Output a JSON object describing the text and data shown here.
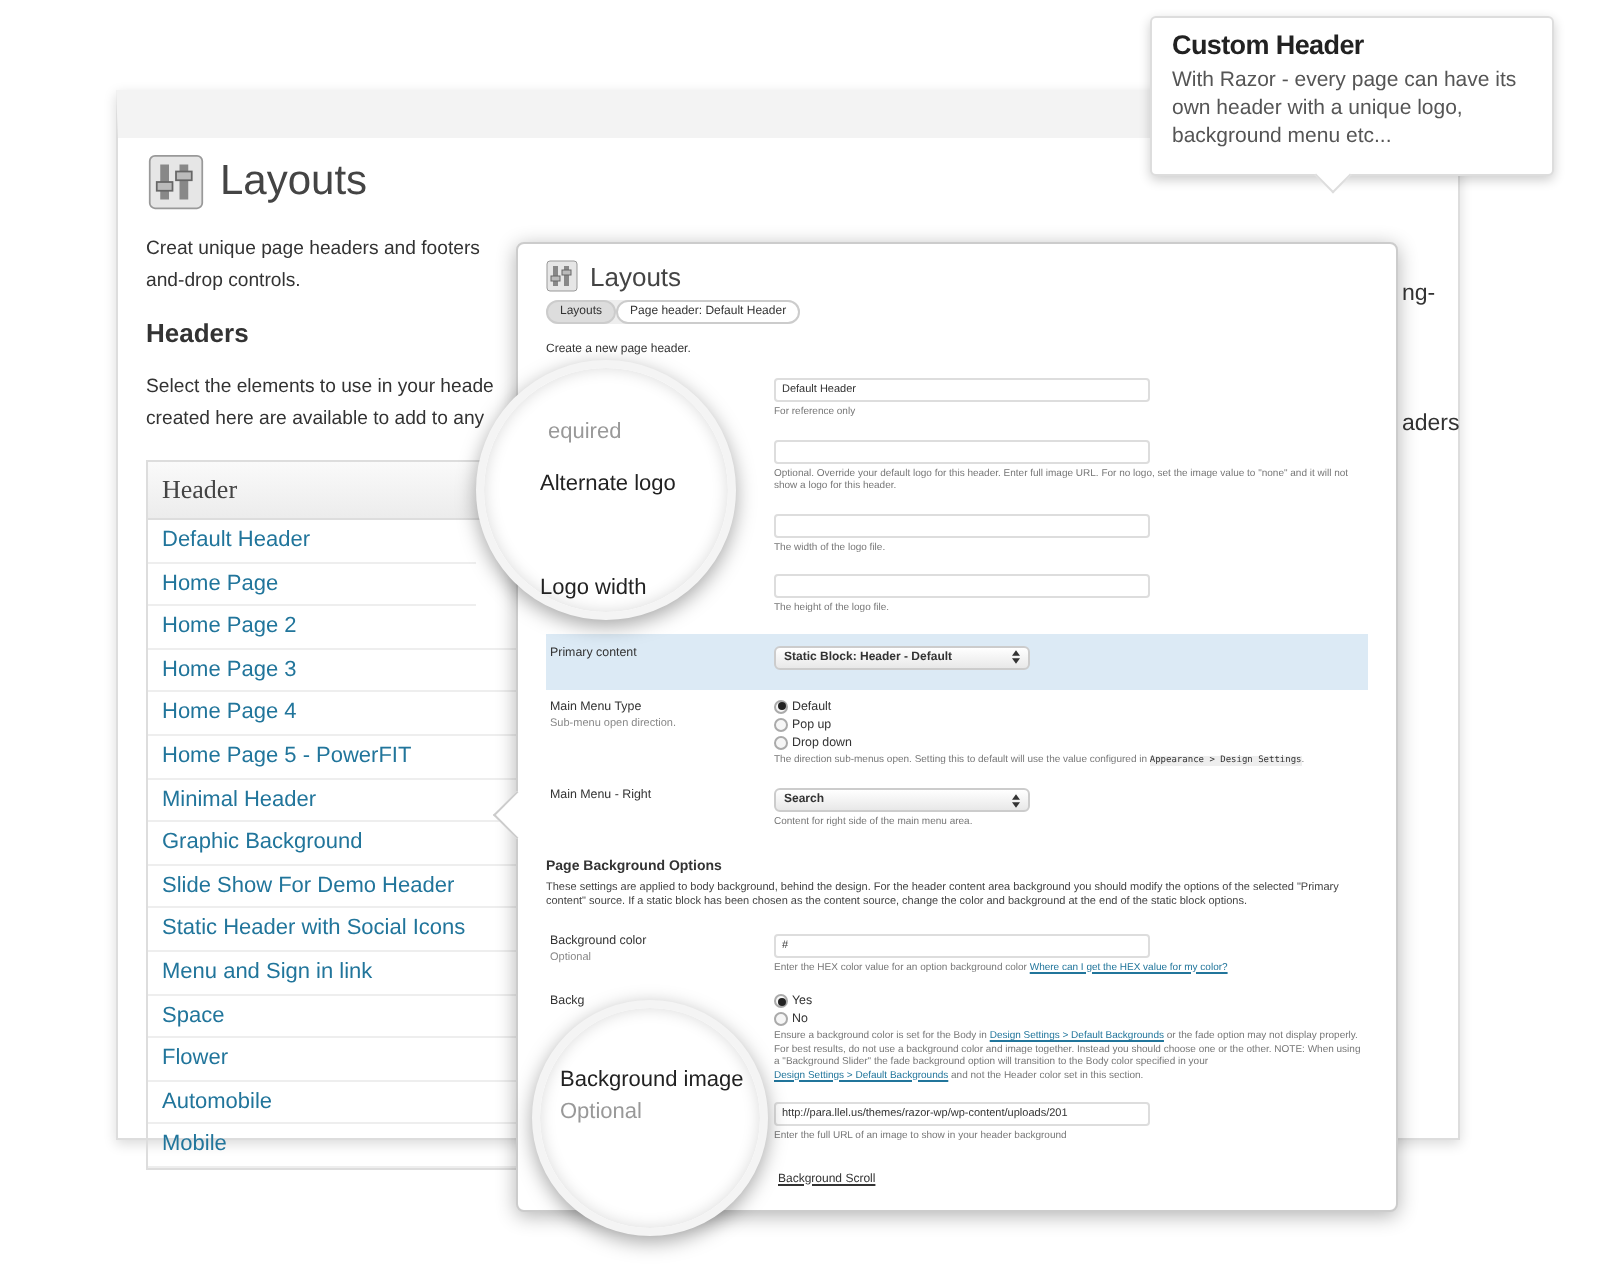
{
  "back_page": {
    "title": "Layouts",
    "intro": "Creat unique page headers and footers",
    "intro_cont": "and-drop controls.",
    "intro_edge": "ng-",
    "section_title": "Headers",
    "section_text": "Select the elements to use in your heade",
    "section_text_2": "created here are available to add to any",
    "section_edge": "aders",
    "table": {
      "columns": [
        "Header"
      ],
      "rows": [
        "Default Header",
        "Home Page",
        "Home Page 2",
        "Home Page 3",
        "Home Page 4",
        "Home Page 5 - PowerFIT",
        "Minimal Header",
        "Graphic Background",
        "Slide Show For Demo Header",
        "Static Header with Social Icons",
        "Menu and Sign in link",
        "Space",
        "Flower",
        "Automobile",
        "Mobile"
      ]
    }
  },
  "popup": {
    "title": "Layouts",
    "tabs": [
      {
        "label": "Layouts",
        "selected": true
      },
      {
        "label": "Page header: Default Header",
        "selected": false
      }
    ],
    "intro": "Create a new page header.",
    "rows": [
      {
        "kind": "text",
        "value": "Default Header",
        "help": [
          {
            "kind": "text",
            "text": "For reference only"
          }
        ]
      },
      {
        "kind": "text",
        "help": [
          {
            "kind": "text",
            "text": "Optional. Override your default logo for this header. Enter full image URL. For no logo, set the image value to \"none\" and it will not show a logo for this header."
          }
        ]
      },
      {
        "kind": "text",
        "help": [
          {
            "kind": "text",
            "text": "The width of the logo file."
          }
        ]
      },
      {
        "kind": "text",
        "help": [
          {
            "kind": "text",
            "text": "The height of the logo file."
          }
        ]
      },
      {
        "kind": "select",
        "label": "Primary content",
        "highlighted": true,
        "value": "Static Block: Header - Default"
      },
      {
        "kind": "radio",
        "label": "Main Menu Type",
        "sublabel": "Sub-menu open direction.",
        "options": [
          {
            "label": "Default",
            "selected": true
          },
          {
            "label": "Pop up",
            "selected": false
          },
          {
            "label": "Drop down",
            "selected": false
          }
        ],
        "help": [
          {
            "kind": "text",
            "text": "The direction sub-menus open. Setting this to default will use the value configured in "
          },
          {
            "kind": "code",
            "text": "Appearance > Design Settings"
          },
          {
            "kind": "text",
            "text": "."
          }
        ]
      },
      {
        "kind": "select",
        "label": "Main Menu - Right",
        "highlighted": false,
        "value": "Search",
        "help": [
          {
            "kind": "text",
            "text": "Content for right side of the main menu area."
          }
        ]
      },
      {
        "kind": "heading",
        "text": "Page Background Options"
      },
      {
        "kind": "paragraph",
        "text": "These settings are applied to body background, behind the design. For the header content area background you should modify the options of the selected \"Primary content\" source. If a static block has been chosen as the content source, change the color and background at the end of the static block options."
      },
      {
        "kind": "text",
        "label": "Background color",
        "sublabel": "Optional",
        "value": "#",
        "help": [
          {
            "kind": "text",
            "text": "Enter the HEX color value for an option background color "
          },
          {
            "kind": "link",
            "text": "Where can I get the HEX value for my color?"
          }
        ]
      },
      {
        "kind": "radio",
        "label": "Backg",
        "options": [
          {
            "label": "Yes",
            "selected": true
          },
          {
            "label": "No",
            "selected": false
          }
        ],
        "help": [
          {
            "kind": "text",
            "text": "Ensure a background color is set for the Body in "
          },
          {
            "kind": "link",
            "text": "Design Settings > Default Backgrounds"
          },
          {
            "kind": "text",
            "text": " or the fade option may not display properly. For best results, do not use a background color and image together. Instead you should choose one or the other. NOTE: When using a \"Background Slider\" the fade background option will transition to the Body color specified in your "
          },
          {
            "kind": "link",
            "text": "Design Settings > Default Backgrounds"
          },
          {
            "kind": "text",
            "text": " and not the Header color set in this section."
          }
        ]
      },
      {
        "kind": "text",
        "value": "http://para.llel.us/themes/razor-wp/wp-content/uploads/201",
        "help": [
          {
            "kind": "text",
            "text": "Enter the full URL of an image to show in your header background"
          }
        ]
      },
      {
        "kind": "heading",
        "text": "Background Scroll"
      }
    ]
  },
  "magnifiers": [
    {
      "labels": [
        {
          "text": "equired",
          "kind": "label"
        },
        {
          "text": "Alternate logo",
          "kind": "label"
        },
        {
          "text": "Logo width",
          "kind": "label"
        }
      ]
    },
    {
      "labels": [
        {
          "text": "Background image",
          "kind": "label"
        },
        {
          "text": "Optional",
          "kind": "sublabel"
        }
      ]
    }
  ],
  "callout": {
    "title": "Custom Header",
    "text": "With Razor - every page can have its own header with a unique logo, background menu etc..."
  }
}
